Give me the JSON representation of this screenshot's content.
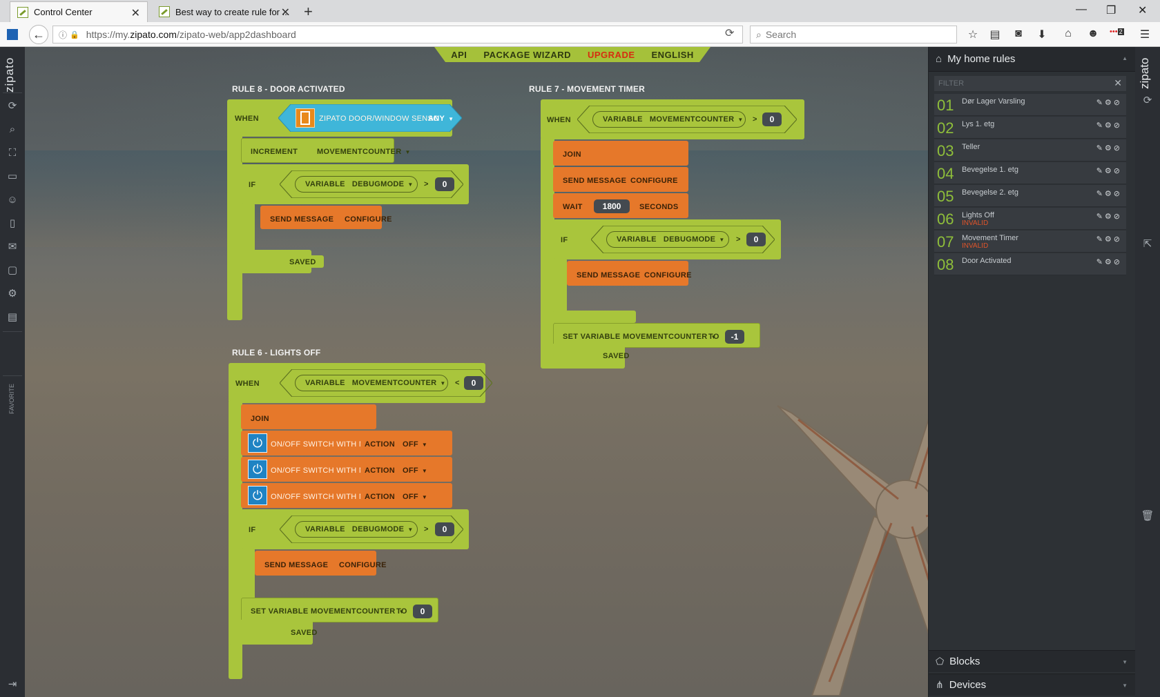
{
  "browser": {
    "tabs": [
      {
        "title": "Control Center"
      },
      {
        "title": "Best way to create rule for ..."
      }
    ],
    "url": {
      "prefix": "https://my.",
      "domain": "zipato.com",
      "path": "/zipato-web/app2dashboard"
    },
    "search_placeholder": "Search",
    "badge_count": "2"
  },
  "app": {
    "left_logo": "zipato",
    "favorite_label": "FAVORITE",
    "top_menu": [
      "API",
      "PACKAGE WIZARD",
      "UPGRADE",
      "ENGLISH"
    ]
  },
  "rules": {
    "rule8": {
      "title": "RULE 8 - DOOR ACTIVATED",
      "when": "WHEN",
      "device": "ZIPATO DOOR/WINDOW SENSC",
      "any": "ANY",
      "increment": "INCREMENT",
      "increment_var": "MOVEMENTCOUNTER",
      "if": "IF",
      "variable": "VARIABLE",
      "var_name": "DEBUGMODE",
      "op": ">",
      "value": "0",
      "send": "SEND MESSAGE",
      "configure": "CONFIGURE",
      "saved": "SAVED"
    },
    "rule7": {
      "title": "RULE 7 - MOVEMENT TIMER",
      "when": "WHEN",
      "variable": "VARIABLE",
      "var_name": "MOVEMENTCOUNTER",
      "op": ">",
      "value": "0",
      "join": "JOIN",
      "send": "SEND MESSAGE",
      "configure": "CONFIGURE",
      "wait": "WAIT",
      "wait_value": "1800",
      "seconds": "SECONDS",
      "if": "IF",
      "if_variable": "VARIABLE",
      "if_var_name": "DEBUGMODE",
      "if_op": ">",
      "if_value": "0",
      "send2": "SEND MESSAGE",
      "configure2": "CONFIGURE",
      "set": "SET VARIABLE",
      "set_var": "MOVEMENTCOUNTER",
      "to": "TO",
      "set_value": "-1",
      "saved": "SAVED"
    },
    "rule6": {
      "title": "RULE 6 - LIGHTS OFF",
      "when": "WHEN",
      "variable": "VARIABLE",
      "var_name": "MOVEMENTCOUNTER",
      "op": "<",
      "value": "0",
      "join": "JOIN",
      "switches": [
        {
          "device": "ON/OFF SWITCH WITH METER L",
          "action": "ACTION",
          "state": "OFF"
        },
        {
          "device": "ON/OFF SWITCH WITH METER L",
          "action": "ACTION",
          "state": "OFF"
        },
        {
          "device": "ON/OFF SWITCH WITH METER L",
          "action": "ACTION",
          "state": "OFF"
        }
      ],
      "if": "IF",
      "if_variable": "VARIABLE",
      "if_var_name": "DEBUGMODE",
      "if_op": ">",
      "if_value": "0",
      "send": "SEND MESSAGE",
      "configure": "CONFIGURE",
      "set": "SET VARIABLE",
      "set_var": "MOVEMENTCOUNTER",
      "to": "TO",
      "set_value": "0",
      "saved": "SAVED"
    }
  },
  "panel": {
    "title": "My home rules",
    "filter_placeholder": "FILTER",
    "rules": [
      {
        "num": "01",
        "name": "Dør Lager Varsling",
        "status": ""
      },
      {
        "num": "02",
        "name": "Lys 1. etg",
        "status": ""
      },
      {
        "num": "03",
        "name": "Teller",
        "status": ""
      },
      {
        "num": "04",
        "name": "Bevegelse 1. etg",
        "status": ""
      },
      {
        "num": "05",
        "name": "Bevegelse 2. etg",
        "status": ""
      },
      {
        "num": "06",
        "name": "Lights Off",
        "status": "INVALID"
      },
      {
        "num": "07",
        "name": "Movement Timer",
        "status": "INVALID"
      },
      {
        "num": "08",
        "name": "Door Activated",
        "status": ""
      }
    ],
    "blocks_label": "Blocks",
    "devices_label": "Devices",
    "right_logo": "zipato"
  },
  "colors": {
    "block_green": "#a9c53c",
    "block_orange": "#e6782a",
    "block_cyan": "#3fb6d9",
    "invalid_red": "#e0542a",
    "upgrade_red": "#d62d10"
  }
}
